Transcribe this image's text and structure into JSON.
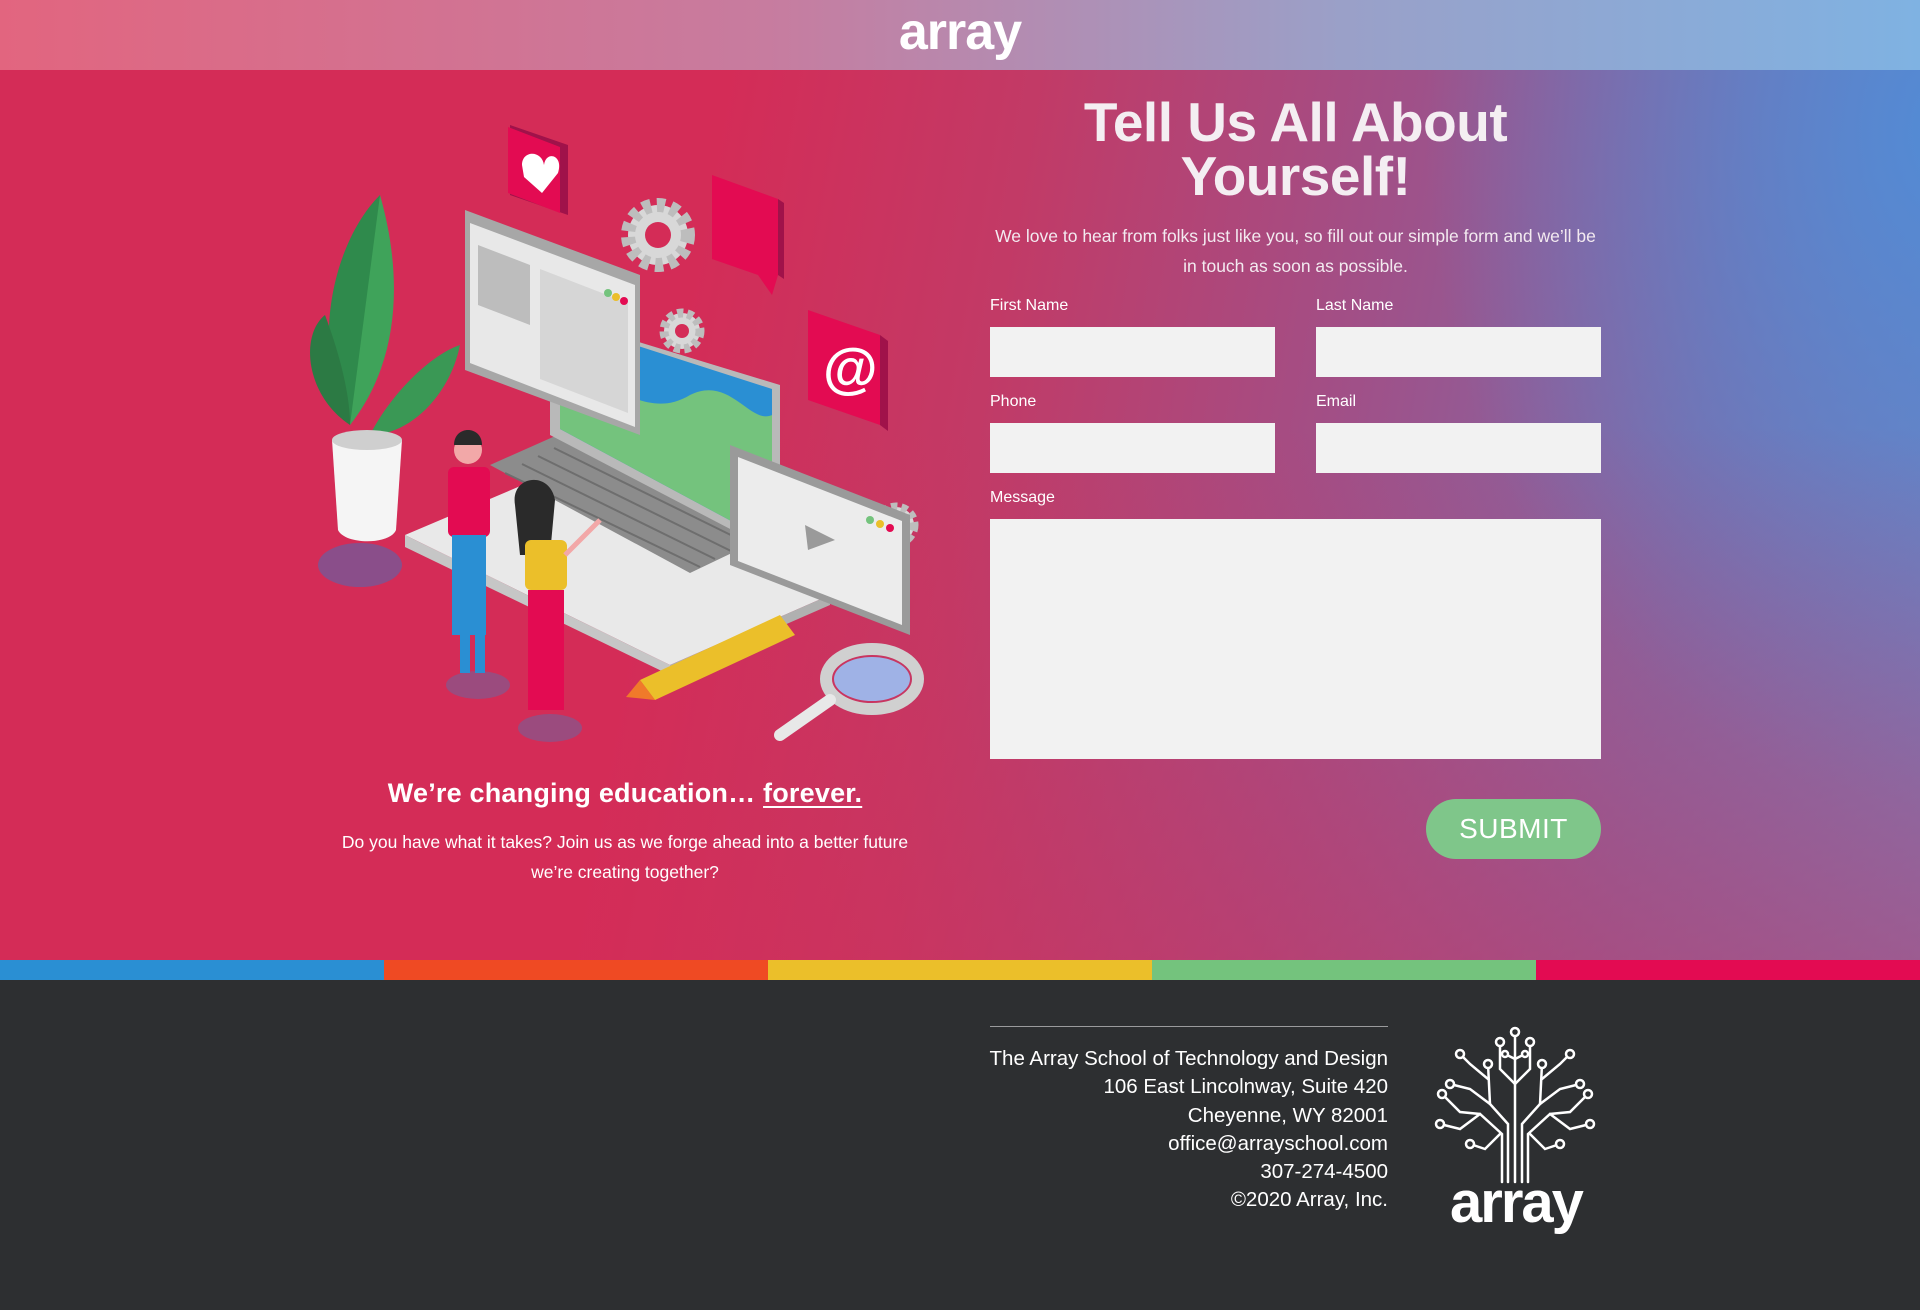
{
  "header": {
    "logo": "array"
  },
  "hero": {
    "tagline_text": "We’re changing education…",
    "tagline_link": "forever.",
    "tagline_body": "Do you have what it takes? Join us as we forge ahead into a better future we’re creating together?"
  },
  "form": {
    "title": "Tell Us All About Yourself!",
    "intro": "We love to hear from folks just like you, so fill out our simple form and we’ll be in touch as soon as possible.",
    "first_name_label": "First Name",
    "first_name_value": "",
    "last_name_label": "Last Name",
    "last_name_value": "",
    "phone_label": "Phone",
    "phone_value": "",
    "email_label": "Email",
    "email_value": "",
    "message_label": "Message",
    "message_value": "",
    "submit_label": "SUBMIT"
  },
  "stripe_colors": [
    "#2a8fd3",
    "#ef4a23",
    "#ebbf2a",
    "#74c37d",
    "#e30b52"
  ],
  "footer": {
    "address": [
      "The Array School of Technology and Design",
      "106 East Lincolnway, Suite 420",
      "Cheyenne, WY 82001",
      "office@arrayschool.com",
      "307-274-4500",
      "©2020 Array, Inc."
    ],
    "logo_word": "array",
    "logo_icon": "circuit-tree-icon"
  },
  "illustration": {
    "icon": "isometric-laptop-people-illustration",
    "elements": [
      "plant-icon",
      "heart-icon",
      "gear-icon",
      "chat-bubble-icon",
      "at-sign-icon",
      "laptop-icon",
      "video-player-icon",
      "pencil-icon",
      "magnifying-glass-icon",
      "person-icon"
    ]
  },
  "colors": {
    "hero_pink": "#d42c57",
    "hero_blue": "#6f82c0",
    "submit_green": "#7fc68a",
    "footer_bg": "#2d2f31"
  }
}
